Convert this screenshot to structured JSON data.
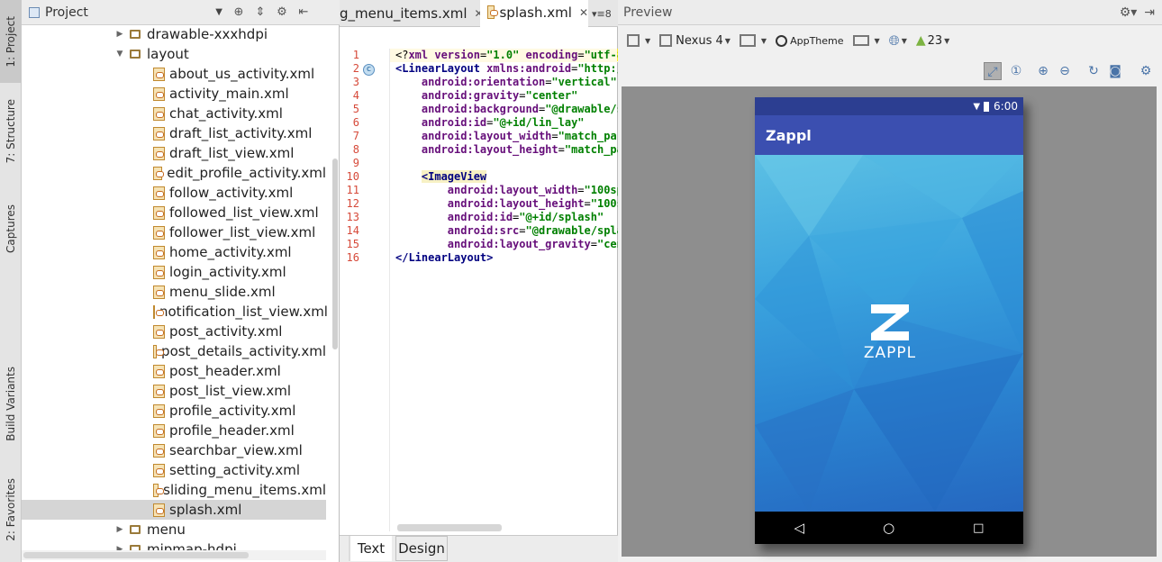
{
  "sidebar_tabs": [
    "1: Project",
    "7: Structure",
    "Captures",
    "Build Variants",
    "2: Favorites"
  ],
  "project": {
    "selector": "Project",
    "tree": [
      {
        "label": "drawable-xxxhdpi",
        "type": "folder",
        "collapsed": true
      },
      {
        "label": "layout",
        "type": "folder",
        "collapsed": false
      },
      {
        "label": "about_us_activity.xml",
        "type": "file"
      },
      {
        "label": "activity_main.xml",
        "type": "file"
      },
      {
        "label": "chat_activity.xml",
        "type": "file"
      },
      {
        "label": "draft_list_activity.xml",
        "type": "file"
      },
      {
        "label": "draft_list_view.xml",
        "type": "file"
      },
      {
        "label": "edit_profile_activity.xml",
        "type": "file"
      },
      {
        "label": "follow_activity.xml",
        "type": "file"
      },
      {
        "label": "followed_list_view.xml",
        "type": "file"
      },
      {
        "label": "follower_list_view.xml",
        "type": "file"
      },
      {
        "label": "home_activity.xml",
        "type": "file"
      },
      {
        "label": "login_activity.xml",
        "type": "file"
      },
      {
        "label": "menu_slide.xml",
        "type": "file"
      },
      {
        "label": "notification_list_view.xml",
        "type": "file"
      },
      {
        "label": "post_activity.xml",
        "type": "file"
      },
      {
        "label": "post_details_activity.xml",
        "type": "file"
      },
      {
        "label": "post_header.xml",
        "type": "file"
      },
      {
        "label": "post_list_view.xml",
        "type": "file"
      },
      {
        "label": "profile_activity.xml",
        "type": "file"
      },
      {
        "label": "profile_header.xml",
        "type": "file"
      },
      {
        "label": "searchbar_view.xml",
        "type": "file"
      },
      {
        "label": "setting_activity.xml",
        "type": "file"
      },
      {
        "label": "sliding_menu_items.xml",
        "type": "file"
      },
      {
        "label": "splash.xml",
        "type": "file",
        "selected": true
      },
      {
        "label": "menu",
        "type": "folder",
        "collapsed": true
      },
      {
        "label": "mipmap-hdpi",
        "type": "folder",
        "collapsed": true
      }
    ]
  },
  "editor": {
    "tabs": [
      {
        "label": "g_menu_items.xml"
      },
      {
        "label": "splash.xml",
        "active": true
      }
    ],
    "tab_overflow": "▾≡8",
    "line_numbers": [
      "1",
      "2",
      "3",
      "4",
      "5",
      "6",
      "7",
      "8",
      "9",
      "10",
      "11",
      "12",
      "13",
      "14",
      "15",
      "16"
    ],
    "gutter_badge": "c",
    "bottom_tabs": [
      "Text",
      "Design"
    ]
  },
  "preview": {
    "title": "Preview",
    "device": "Nexus 4",
    "theme": "AppTheme",
    "api": "23",
    "status_time": "6:00",
    "app_title": "Zappl",
    "logo_text": "ZAPPL"
  },
  "colors": {
    "accent": "#3b4fb0",
    "statusbar": "#2c3e91",
    "code_tag": "#000080",
    "code_attr": "#660e7a",
    "code_value": "#008000"
  }
}
